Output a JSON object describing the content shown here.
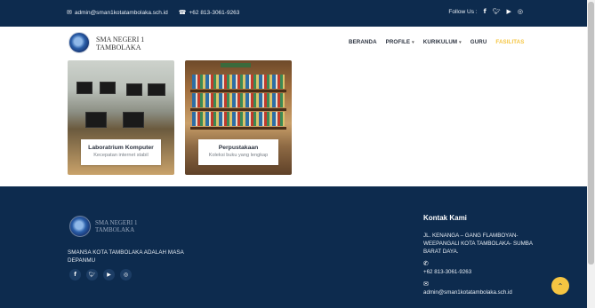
{
  "topbar": {
    "email": "admin@sman1kotatambolaka.sch.id",
    "phone": "+62 813-3061-9263",
    "follow_label": "Follow Us :",
    "social_icons": [
      "facebook-icon",
      "twitter-icon",
      "youtube-icon",
      "instagram-icon"
    ]
  },
  "header": {
    "brand_line1": "SMA NEGERI 1",
    "brand_line2": "TAMBOLAKA",
    "nav": [
      {
        "label": "BERANDA"
      },
      {
        "label": "PROFILE"
      },
      {
        "label": "KURIKULUM"
      },
      {
        "label": "GURU"
      },
      {
        "label": "FASILITAS"
      }
    ]
  },
  "cards": [
    {
      "title": "Laboratrium Komputer",
      "subtitle": "Kecepatan internet stabil"
    },
    {
      "title": "Perpustakaan",
      "subtitle": "Koleksi buku yang lengkap"
    }
  ],
  "footer": {
    "brand_line1": "SMA NEGERI 1",
    "brand_line2": "TAMBOLAKA",
    "tagline": "SMANSA KOTA TAMBOLAKA ADALAH MASA DEPANMU",
    "contact": {
      "heading": "Kontak Kami",
      "address": "JL. KENANGA – GANG FLAMBOYAN- WEEPANGALI KOTA TAMBOLAKA- SUMBA BARAT DAYA.",
      "phone": "+62 813-3061-9263",
      "email": "admin@sman1kotatambolaka.sch.id"
    }
  },
  "colors": {
    "navy": "#0d2b4e",
    "accent": "#f5c542"
  }
}
